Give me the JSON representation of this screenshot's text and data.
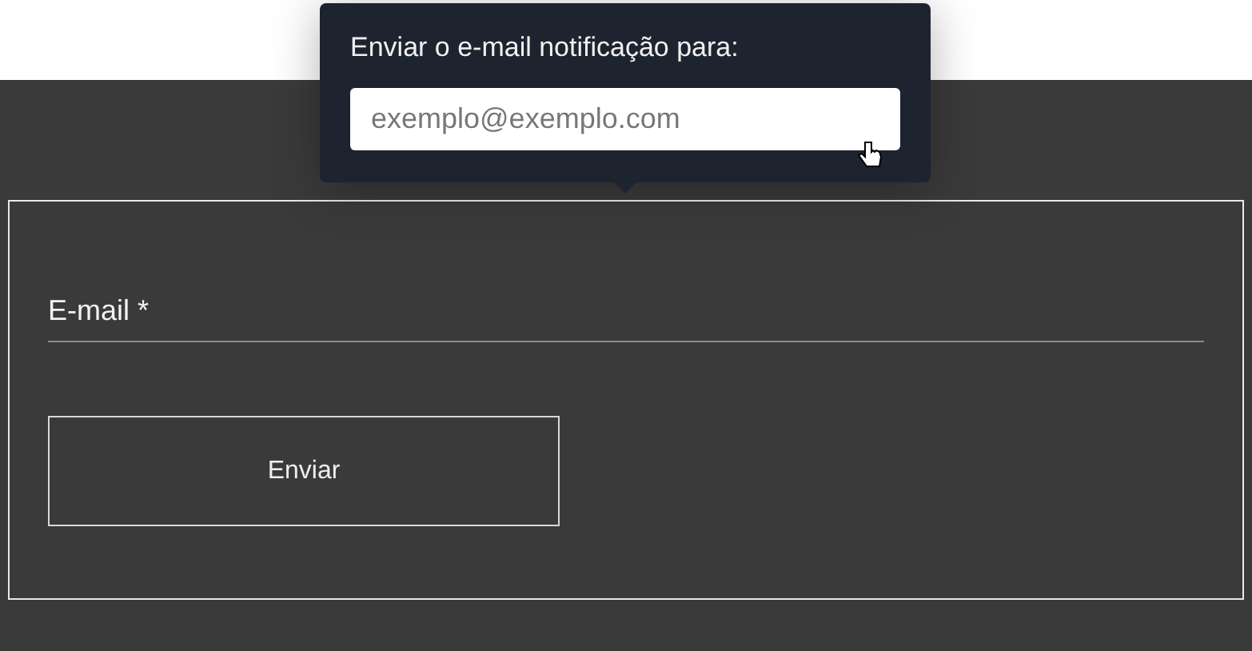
{
  "popover": {
    "title": "Enviar o e-mail notificação para:",
    "email_field": {
      "placeholder": "exemplo@exemplo.com"
    }
  },
  "form": {
    "email_label": "E-mail *",
    "submit_button": "Enviar"
  }
}
